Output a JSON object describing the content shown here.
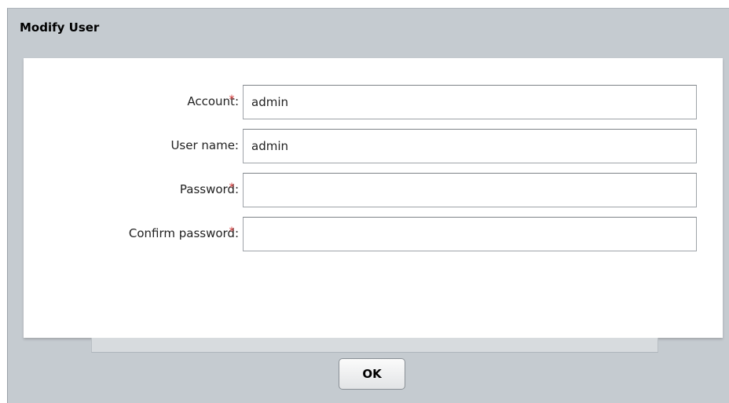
{
  "dialog": {
    "title": "Modify User",
    "required_marker": "*",
    "fields": [
      {
        "label": "Account:",
        "required": true,
        "value": "admin",
        "type": "text"
      },
      {
        "label": "User name:",
        "required": false,
        "value": "admin",
        "type": "text"
      },
      {
        "label": "Password:",
        "required": true,
        "value": "",
        "type": "password"
      },
      {
        "label": "Confirm password:",
        "required": true,
        "value": "",
        "type": "password"
      }
    ],
    "ok_label": "OK"
  },
  "colors": {
    "dialog_bg": "#c5cbd0",
    "required_marker": "#d23a3a"
  }
}
